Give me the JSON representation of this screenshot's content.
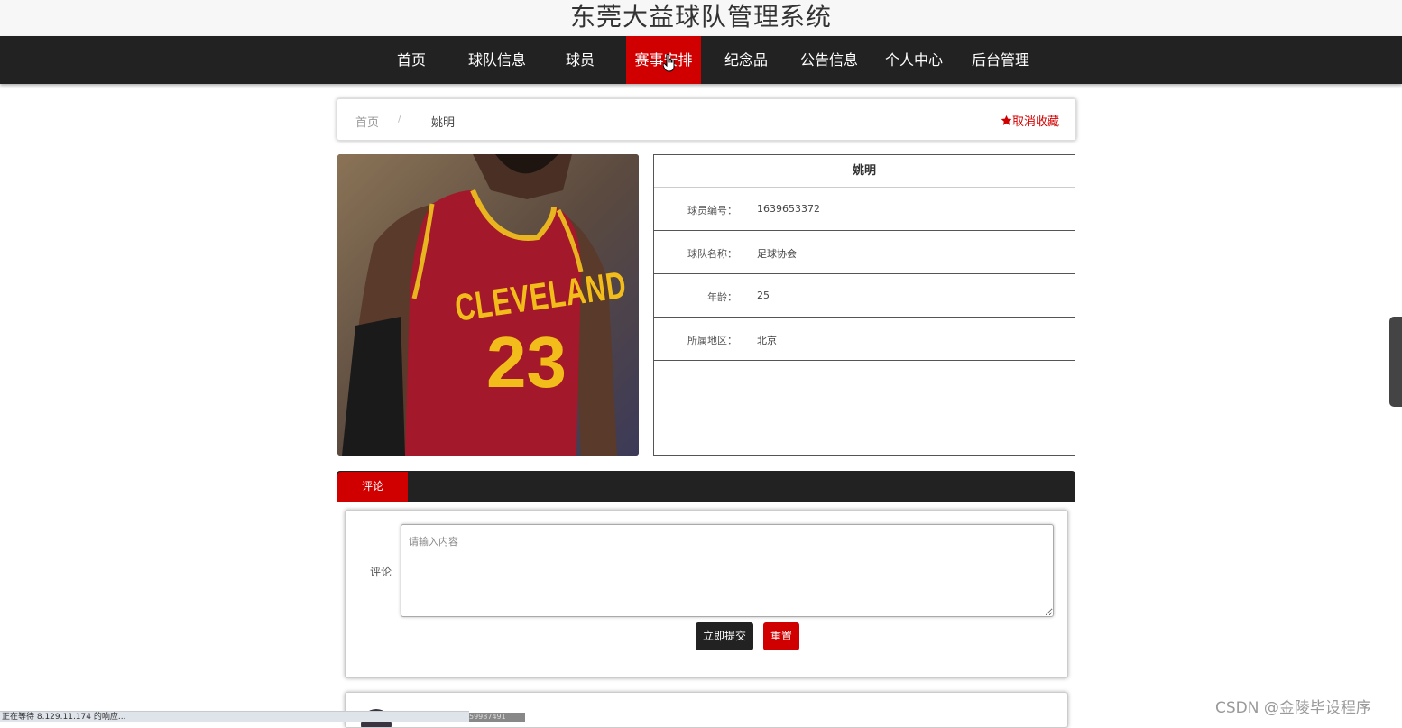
{
  "site": {
    "title": "东莞大益球队管理系统"
  },
  "nav": {
    "items": [
      {
        "label": "首页"
      },
      {
        "label": "球队信息"
      },
      {
        "label": "球员"
      },
      {
        "label": "赛事安排"
      },
      {
        "label": "纪念品"
      },
      {
        "label": "公告信息"
      },
      {
        "label": "个人中心"
      },
      {
        "label": "后台管理"
      }
    ],
    "active_index": 3
  },
  "breadcrumb": {
    "home": "首页",
    "sep": "/",
    "current": "姚明"
  },
  "favorite": {
    "label": "取消收藏",
    "icon": "star-icon"
  },
  "player": {
    "name": "姚明",
    "photo": {
      "jersey_text": "CLEVELAND",
      "jersey_number": "23"
    },
    "fields": [
      {
        "label": "球员编号：",
        "value": "1639653372"
      },
      {
        "label": "球队名称：",
        "value": "足球协会"
      },
      {
        "label": "年龄：",
        "value": "25"
      },
      {
        "label": "所属地区：",
        "value": "北京"
      }
    ]
  },
  "tabs": {
    "active": "评论"
  },
  "comment_form": {
    "label": "评论",
    "placeholder": "请输入内容",
    "submit": "立即提交",
    "reset": "重置"
  },
  "status_bar": {
    "text": "正在等待 8.129.11.174 的响应...",
    "tail": "59987491"
  },
  "watermark": "CSDN @金陵毕设程序",
  "colors": {
    "accent": "#d10000",
    "nav_bg": "#222222",
    "title_bg": "#f7f7f7"
  }
}
